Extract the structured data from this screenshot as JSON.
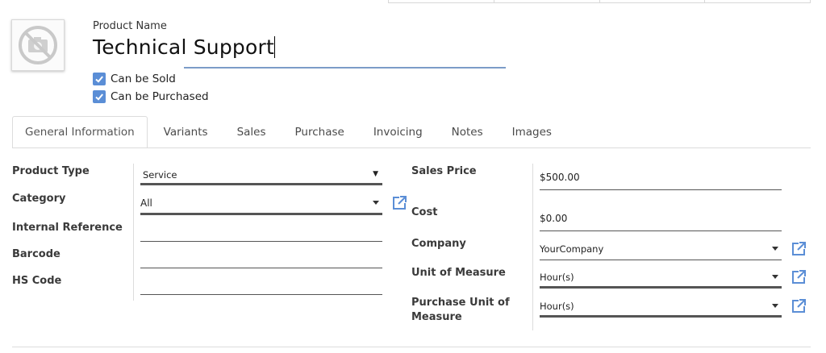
{
  "header": {
    "product_name_label": "Product Name",
    "product_name_value": "Technical Support",
    "can_be_sold_label": "Can be Sold",
    "can_be_purchased_label": "Can be Purchased"
  },
  "tabs": [
    {
      "label": "General Information",
      "active": true
    },
    {
      "label": "Variants"
    },
    {
      "label": "Sales"
    },
    {
      "label": "Purchase"
    },
    {
      "label": "Invoicing"
    },
    {
      "label": "Notes"
    },
    {
      "label": "Images"
    }
  ],
  "left_fields": {
    "product_type": {
      "label": "Product Type",
      "value": "Service"
    },
    "category": {
      "label": "Category",
      "value": "All"
    },
    "internal_reference": {
      "label": "Internal Reference",
      "value": ""
    },
    "barcode": {
      "label": "Barcode",
      "value": ""
    },
    "hs_code": {
      "label": "HS Code",
      "value": ""
    }
  },
  "right_fields": {
    "sales_price": {
      "label": "Sales Price",
      "value": "$500.00"
    },
    "cost": {
      "label": "Cost",
      "value": "$0.00"
    },
    "company": {
      "label": "Company",
      "value": "YourCompany"
    },
    "unit_of_measure": {
      "label": "Unit of Measure",
      "value": "Hour(s)"
    },
    "purchase_uom": {
      "label_line1": "Purchase Unit of",
      "label_line2": "Measure",
      "value": "Hour(s)"
    }
  },
  "colors": {
    "accent": "#5b8ed6",
    "link_icon": "#5b8ed6"
  }
}
